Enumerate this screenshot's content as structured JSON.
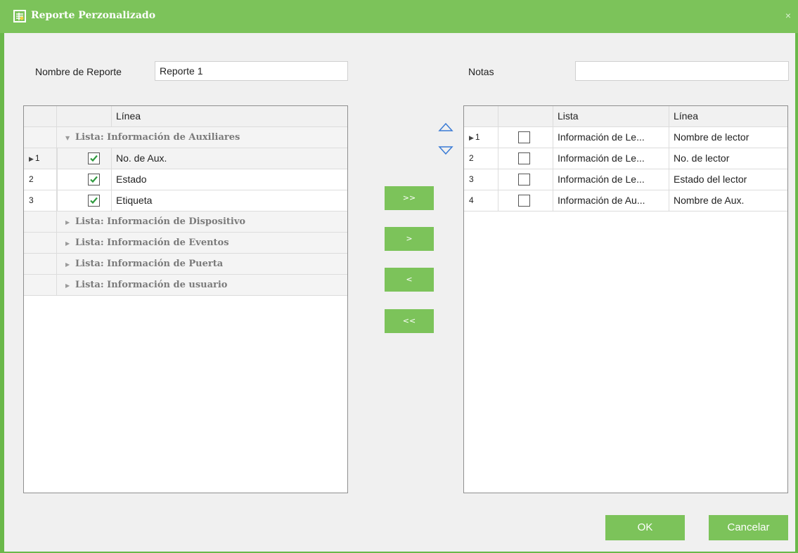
{
  "window": {
    "title": "Reporte Perzonalizado",
    "close_glyph": "×",
    "accent": "#7cc35a"
  },
  "form": {
    "report_name_label": "Nombre de Reporte",
    "report_name_value": "Reporte 1",
    "notes_label": "Notas",
    "notes_value": ""
  },
  "left_grid": {
    "column_header": "Línea",
    "groups": [
      {
        "label": "Lista: Información de Auxiliares",
        "expanded": true,
        "rows": [
          {
            "num": "1",
            "current": true,
            "checked": true,
            "label": "No. de Aux."
          },
          {
            "num": "2",
            "current": false,
            "checked": true,
            "label": "Estado"
          },
          {
            "num": "3",
            "current": false,
            "checked": true,
            "label": "Etiqueta"
          }
        ]
      },
      {
        "label": "Lista: Información de Dispositivo",
        "expanded": false
      },
      {
        "label": "Lista: Información de Eventos",
        "expanded": false
      },
      {
        "label": "Lista: Información de Puerta",
        "expanded": false
      },
      {
        "label": "Lista: Información de usuario",
        "expanded": false
      }
    ]
  },
  "move_buttons": {
    "add_all": ">>",
    "add": ">",
    "remove": "<",
    "remove_all": "<<"
  },
  "order_buttons": {
    "up": "move-up-icon",
    "down": "move-down-icon"
  },
  "right_grid": {
    "columns": [
      "Lista",
      "Línea"
    ],
    "rows": [
      {
        "num": "1",
        "current": true,
        "checked": false,
        "lista": "Información de Le...",
        "linea": "Nombre de lector"
      },
      {
        "num": "2",
        "current": false,
        "checked": false,
        "lista": "Información de Le...",
        "linea": "No. de lector"
      },
      {
        "num": "3",
        "current": false,
        "checked": false,
        "lista": "Información de Le...",
        "linea": "Estado del lector"
      },
      {
        "num": "4",
        "current": false,
        "checked": false,
        "lista": "Información de Au...",
        "linea": "Nombre de Aux."
      }
    ]
  },
  "footer": {
    "ok_label": "OK",
    "cancel_label": "Cancelar"
  }
}
